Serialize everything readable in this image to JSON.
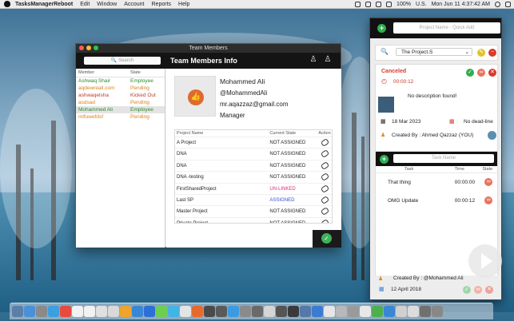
{
  "menubar": {
    "app_name": "TasksManagerReboot",
    "menus": [
      "Edit",
      "Window",
      "Account",
      "Reports",
      "Help"
    ],
    "battery": "100%",
    "locale": "U.S.",
    "datetime": "Mon Jun 11  4:37:42 AM"
  },
  "team_window": {
    "title": "Team Members",
    "search_placeholder": "Search",
    "header": "Team Members Info",
    "list_headers": {
      "member": "Member",
      "state": "State"
    },
    "members": [
      {
        "name": "Ashwaq Shair",
        "state": "Employee",
        "color": "#2f8a2f"
      },
      {
        "name": "aqdewreall.com",
        "state": "Pending",
        "color": "#d9841c"
      },
      {
        "name": "ashwaqelsha",
        "state": "Kicked Out",
        "color": "#c0392b"
      },
      {
        "name": "asdsad",
        "state": "Pending",
        "color": "#d9841c"
      },
      {
        "name": "Mohammed Ali",
        "state": "Employee",
        "color": "#2f8a2f",
        "selected": true
      },
      {
        "name": "mlfuwefdsf",
        "state": "Pending",
        "color": "#d9841c"
      }
    ],
    "profile": {
      "name": "Mohammed Ali",
      "handle": "@MohammedAli",
      "email": "mr.aqazzaz@gmail.com",
      "role": "Manager"
    },
    "table_headers": {
      "project": "Project Name",
      "state": "Current State",
      "action": "Action"
    },
    "projects": [
      {
        "name": "A Project",
        "state": "NOT ASSIGNED",
        "color": "#222222"
      },
      {
        "name": "DNA",
        "state": "NOT ASSIGNED",
        "color": "#222222"
      },
      {
        "name": "DNA",
        "state": "NOT ASSIGNED",
        "color": "#222222"
      },
      {
        "name": "DNA -testing",
        "state": "NOT ASSIGNED",
        "color": "#222222"
      },
      {
        "name": "FirstSharedProject",
        "state": "UN-LINKED",
        "color": "#d62d7a"
      },
      {
        "name": "Last SP",
        "state": "ASSIGNED",
        "color": "#2d4fd6"
      },
      {
        "name": "Master Project",
        "state": "NOT ASSIGNED",
        "color": "#222222"
      },
      {
        "name": "Private Project",
        "state": "NOT ASSIGNED",
        "color": "#222222"
      }
    ]
  },
  "project_panel": {
    "name_placeholder": "Project Name - Quick Add",
    "selected_project": "The Project.S",
    "status": "Canceled",
    "elapsed": "00:00:12",
    "description": "No description found!",
    "date": "18 Mar 2023",
    "deadline": "No dead-line",
    "created_by": "Created By : Ahmed Qazzaz (YOU)",
    "task_placeholder": "Task Name",
    "task_headers": {
      "task": "Task",
      "time": "Time",
      "state": "State"
    },
    "tasks": [
      {
        "name": "That thing",
        "time": "00:00:00"
      },
      {
        "name": "OMG Update",
        "time": "00:00:12"
      }
    ],
    "footer_created_by": "Created By : @Mohammed Ali",
    "footer_date": "12 April 2018"
  },
  "colors": {
    "accent_green": "#2fae4f",
    "danger": "#d63b2f",
    "pending": "#d9841c"
  }
}
